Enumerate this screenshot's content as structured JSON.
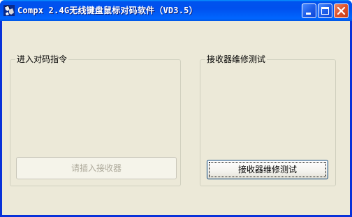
{
  "window": {
    "title": "Compx 2.4G无线键盘鼠标对码软件（VD3.5）"
  },
  "pairing_group": {
    "label": "进入对码指令",
    "button_label": "请插入接收器"
  },
  "repair_group": {
    "label": "接收器维修测试",
    "button_label": "接收器维修测试"
  },
  "icons": {
    "app": "app-icon",
    "minimize": "minimize-icon",
    "maximize": "maximize-icon",
    "close": "close-icon"
  },
  "colors": {
    "titlebar": "#0054e3",
    "client_bg": "#ece9d8",
    "close_button": "#e0552f",
    "disabled_text": "#aca899"
  }
}
